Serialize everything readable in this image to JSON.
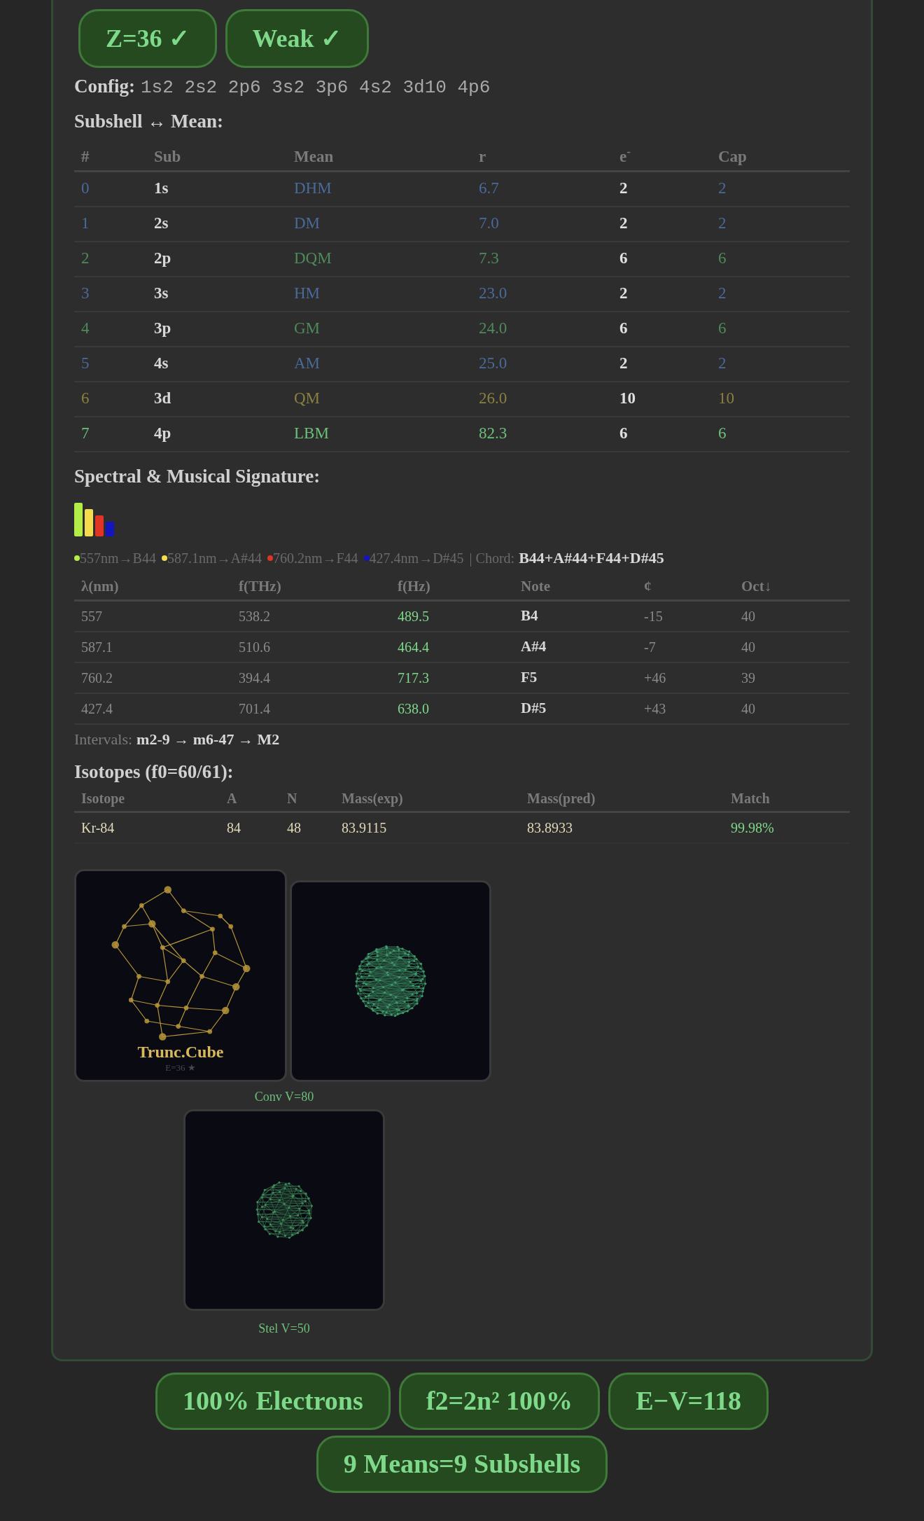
{
  "badges": [
    {
      "label": "Z=36 ✓"
    },
    {
      "label": "Weak ✓"
    }
  ],
  "config": {
    "label": "Config:",
    "value": "1s2 2s2 2p6 3s2 3p6 4s2 3d10 4p6"
  },
  "subshells": {
    "title": "Subshell ↔ Mean:",
    "columns": [
      "#",
      "Sub",
      "Mean",
      "r",
      "e$^{-}$",
      "Cap"
    ],
    "rows": [
      {
        "index": "0",
        "sub": "1s",
        "mean": "DHM",
        "r": "6.7",
        "electrons": "2",
        "cap": "2",
        "color": "#4a6a9a"
      },
      {
        "index": "1",
        "sub": "2s",
        "mean": "DM",
        "r": "7.0",
        "electrons": "2",
        "cap": "2",
        "color": "#4a6a9a"
      },
      {
        "index": "2",
        "sub": "2p",
        "mean": "DQM",
        "r": "7.3",
        "electrons": "6",
        "cap": "6",
        "color": "#4f8a5a"
      },
      {
        "index": "3",
        "sub": "3s",
        "mean": "HM",
        "r": "23.0",
        "electrons": "2",
        "cap": "2",
        "color": "#4a6a9a"
      },
      {
        "index": "4",
        "sub": "3p",
        "mean": "GM",
        "r": "24.0",
        "electrons": "6",
        "cap": "6",
        "color": "#4f8a5a"
      },
      {
        "index": "5",
        "sub": "4s",
        "mean": "AM",
        "r": "25.0",
        "electrons": "2",
        "cap": "2",
        "color": "#4a6a9a"
      },
      {
        "index": "6",
        "sub": "3d",
        "mean": "QM",
        "r": "26.0",
        "electrons": "10",
        "cap": "10",
        "color": "#8a8040"
      },
      {
        "index": "7",
        "sub": "4p",
        "mean": "LBM",
        "r": "82.3",
        "electrons": "6",
        "cap": "6",
        "color": "#6cc078"
      }
    ]
  },
  "spectral": {
    "title": "Spectral & Musical Signature:",
    "bars": [
      {
        "color": "#b4ec48"
      },
      {
        "color": "#f4dc4c"
      },
      {
        "color": "#e03424"
      },
      {
        "color": "#1414c0"
      }
    ],
    "lines": [
      {
        "text": "557nm→B44",
        "color": "#b4ec48"
      },
      {
        "text": "587.1nm→A#44",
        "color": "#f4dc4c"
      },
      {
        "text": "760.2nm→F44",
        "color": "#e03424"
      },
      {
        "text": "427.4nm→D#45",
        "color": "#1414c0"
      }
    ],
    "chord_label": "| Chord:",
    "chord": "B44+A#44+F44+D#45",
    "columns": [
      "λ(nm)",
      "f(THz)",
      "f(Hz)",
      "Note",
      "¢",
      "Oct↓"
    ],
    "rows": [
      {
        "wavelength": "557",
        "thz": "538.2",
        "hz": "489.5",
        "note": "B4",
        "cents": "-15",
        "octave": "40"
      },
      {
        "wavelength": "587.1",
        "thz": "510.6",
        "hz": "464.4",
        "note": "A#4",
        "cents": "-7",
        "octave": "40"
      },
      {
        "wavelength": "760.2",
        "thz": "394.4",
        "hz": "717.3",
        "note": "F5",
        "cents": "+46",
        "octave": "39"
      },
      {
        "wavelength": "427.4",
        "thz": "701.4",
        "hz": "638.0",
        "note": "D#5",
        "cents": "+43",
        "octave": "40"
      }
    ],
    "intervals_label": "Intervals:",
    "intervals": "m2-9 → m6-47 → M2"
  },
  "isotopes": {
    "title": "Isotopes (f0=60/61):",
    "columns": [
      "Isotope",
      "A",
      "N",
      "Mass(exp)",
      "Mass(pred)",
      "Match"
    ],
    "rows": [
      {
        "isotope": "Kr-84",
        "a": "84",
        "n": "48",
        "mass_exp": "83.9115",
        "mass_pred": "83.8933",
        "match": "99.98%"
      }
    ]
  },
  "figures": [
    {
      "kind": "polyhedron",
      "title": "Trunc.Cube",
      "subtitle": "E=36 ★"
    },
    {
      "kind": "sphere",
      "caption": "Conv V=80"
    },
    {
      "kind": "small-sphere",
      "caption": "Stel V=50"
    }
  ],
  "footer_badges": [
    {
      "label": "100% Electrons"
    },
    {
      "label": "f2=2n² 100%"
    },
    {
      "label": "E−V=118"
    },
    {
      "label": "9 Means=9 Subshells"
    }
  ]
}
